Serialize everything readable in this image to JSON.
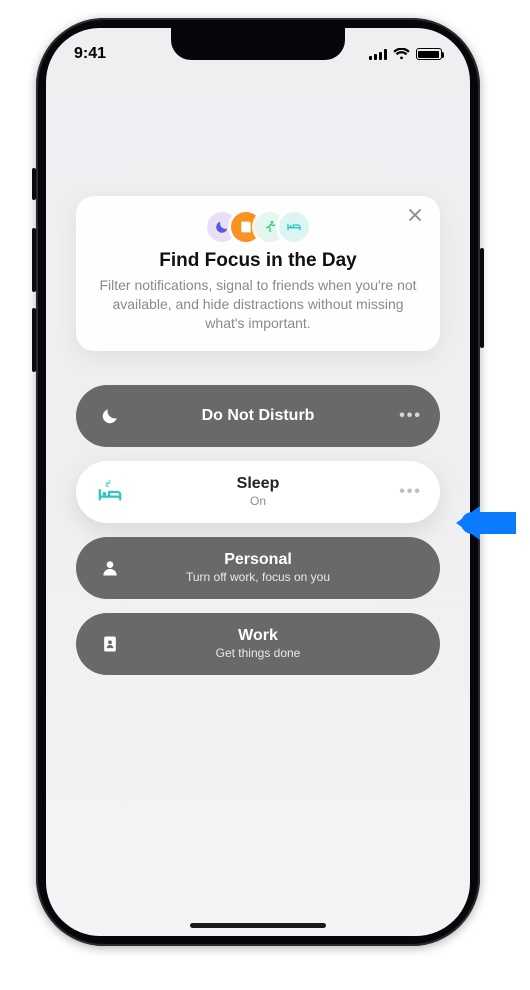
{
  "status": {
    "time": "9:41"
  },
  "promo": {
    "title": "Find Focus in the Day",
    "body": "Filter notifications, signal to friends when you're not available, and hide distractions without missing what's important.",
    "icons": [
      "moon",
      "book",
      "runner",
      "bed"
    ]
  },
  "focus_modes": [
    {
      "id": "dnd",
      "title": "Do Not Disturb",
      "subtitle": "",
      "active": false,
      "icon": "moon",
      "shows_more": true
    },
    {
      "id": "sleep",
      "title": "Sleep",
      "subtitle": "On",
      "active": true,
      "icon": "bed",
      "shows_more": true
    },
    {
      "id": "personal",
      "title": "Personal",
      "subtitle": "Turn off work, focus on you",
      "active": false,
      "icon": "person",
      "shows_more": false
    },
    {
      "id": "work",
      "title": "Work",
      "subtitle": "Get things done",
      "active": false,
      "icon": "badge",
      "shows_more": false
    }
  ],
  "colors": {
    "accent_teal": "#2BC5C3",
    "accent_purple": "#5B5AD6",
    "accent_orange": "#F7931E",
    "arrow_blue": "#0A7AFF"
  }
}
